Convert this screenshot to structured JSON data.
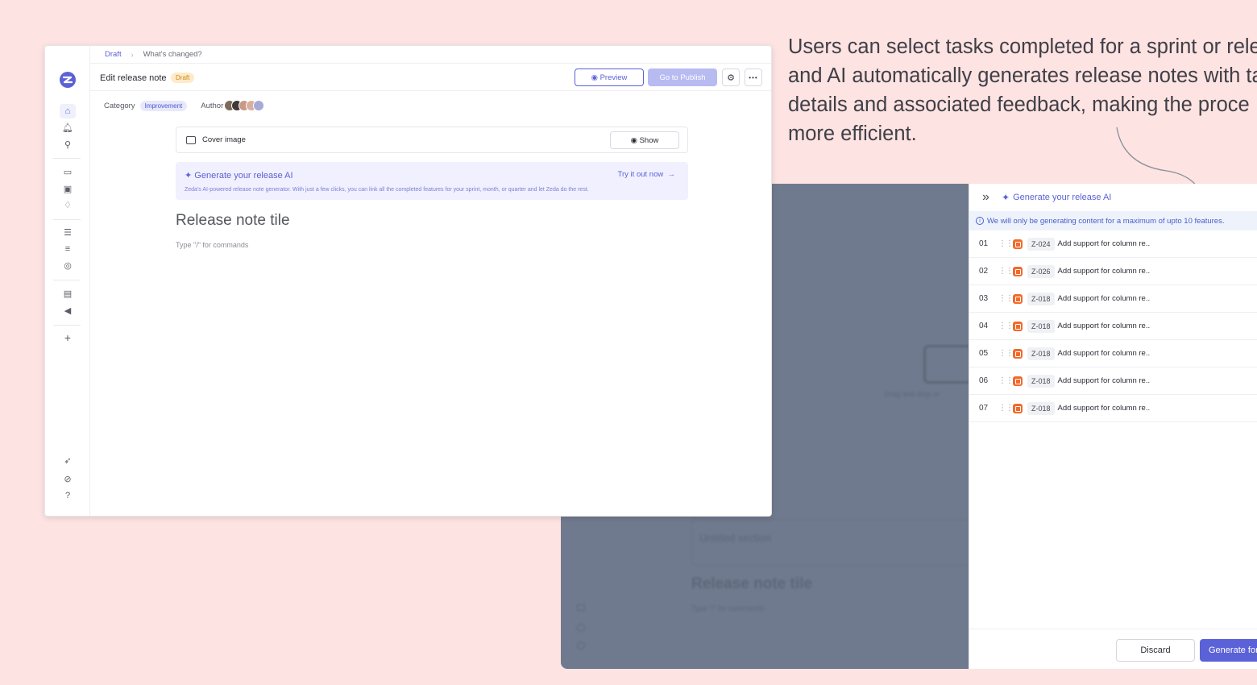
{
  "caption": {
    "lines": [
      "Users can select tasks completed for a sprint or relea",
      "and AI automatically generates release notes with ta",
      "details and associated feedback, making the proce",
      "more efficient."
    ]
  },
  "editor": {
    "breadcrumb": {
      "root": "Draft",
      "current": "What's changed?"
    },
    "title": "Edit release note",
    "status_badge": "Draft",
    "preview_label": "Preview",
    "publish_label": "Go to Publish",
    "more_label": "•••",
    "category_label": "Category",
    "category_value": "Improvement",
    "author_label": "Author",
    "author_avatar_colors": [
      "#7c6b5d",
      "#3f3a37",
      "#c89a8a",
      "#d8b0a0",
      "#a7a9d6"
    ],
    "cover_image_label": "Cover image",
    "show_label": "Show",
    "ai_banner": {
      "title": "Generate your release AI",
      "cta": "Try it out now",
      "description": "Zeda's AI-powered release note generator. With just a few clicks, you can link all the completed features for your sprint, month, or quarter and let Zeda do the rest."
    },
    "note_title_placeholder": "Release note tile",
    "command_hint": "Type \"/\" for commands"
  },
  "ai_panel": {
    "title": "Generate your release AI",
    "notice": "We will only be generating content for a maximum of upto 10 features.",
    "features": [
      {
        "num": "01",
        "id": "Z-024",
        "title": "Add support for column re.."
      },
      {
        "num": "02",
        "id": "Z-026",
        "title": "Add support for column re.."
      },
      {
        "num": "03",
        "id": "Z-018",
        "title": "Add support for column re.."
      },
      {
        "num": "04",
        "id": "Z-018",
        "title": "Add support for column re.."
      },
      {
        "num": "05",
        "id": "Z-018",
        "title": "Add support for column re.."
      },
      {
        "num": "06",
        "id": "Z-018",
        "title": "Add support for column re.."
      },
      {
        "num": "07",
        "id": "Z-018",
        "title": "Add support for column re.."
      }
    ],
    "discard_label": "Discard",
    "generate_label": "Generate for"
  },
  "background_window": {
    "drag_text": "Drag and drop or",
    "section_heading": "Untitled section",
    "note_title": "Release note tile",
    "command_hint": "Type \"/\" for commands"
  },
  "colors": {
    "accent": "#5b61d6",
    "background": "#fde3e1",
    "feature_icon": "#f26a2b",
    "draft_badge": "#fdebc9"
  }
}
